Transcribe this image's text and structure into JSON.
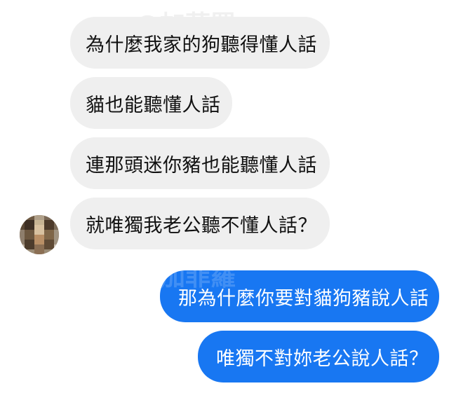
{
  "conversation": {
    "messages": [
      {
        "sender": "incoming",
        "text": "為什麼我家的狗聽得懂人話"
      },
      {
        "sender": "incoming",
        "text": "貓也能聽懂人話"
      },
      {
        "sender": "incoming",
        "text": "連那頭迷你豬也能聽懂人話"
      },
      {
        "sender": "incoming",
        "text": "就唯獨我老公聽不懂人話？"
      },
      {
        "sender": "outgoing",
        "text": "那為什麼你要對貓狗豬說人話"
      },
      {
        "sender": "outgoing",
        "text": "唯獨不對妳老公說人話？"
      }
    ],
    "watermark": "@加菲羅"
  },
  "colors": {
    "incoming_bubble": "#efefef",
    "outgoing_bubble": "#1877f2",
    "incoming_text": "#111111",
    "outgoing_text": "#ffffff"
  },
  "icons": {
    "avatar": "pixelated-avatar-icon"
  }
}
